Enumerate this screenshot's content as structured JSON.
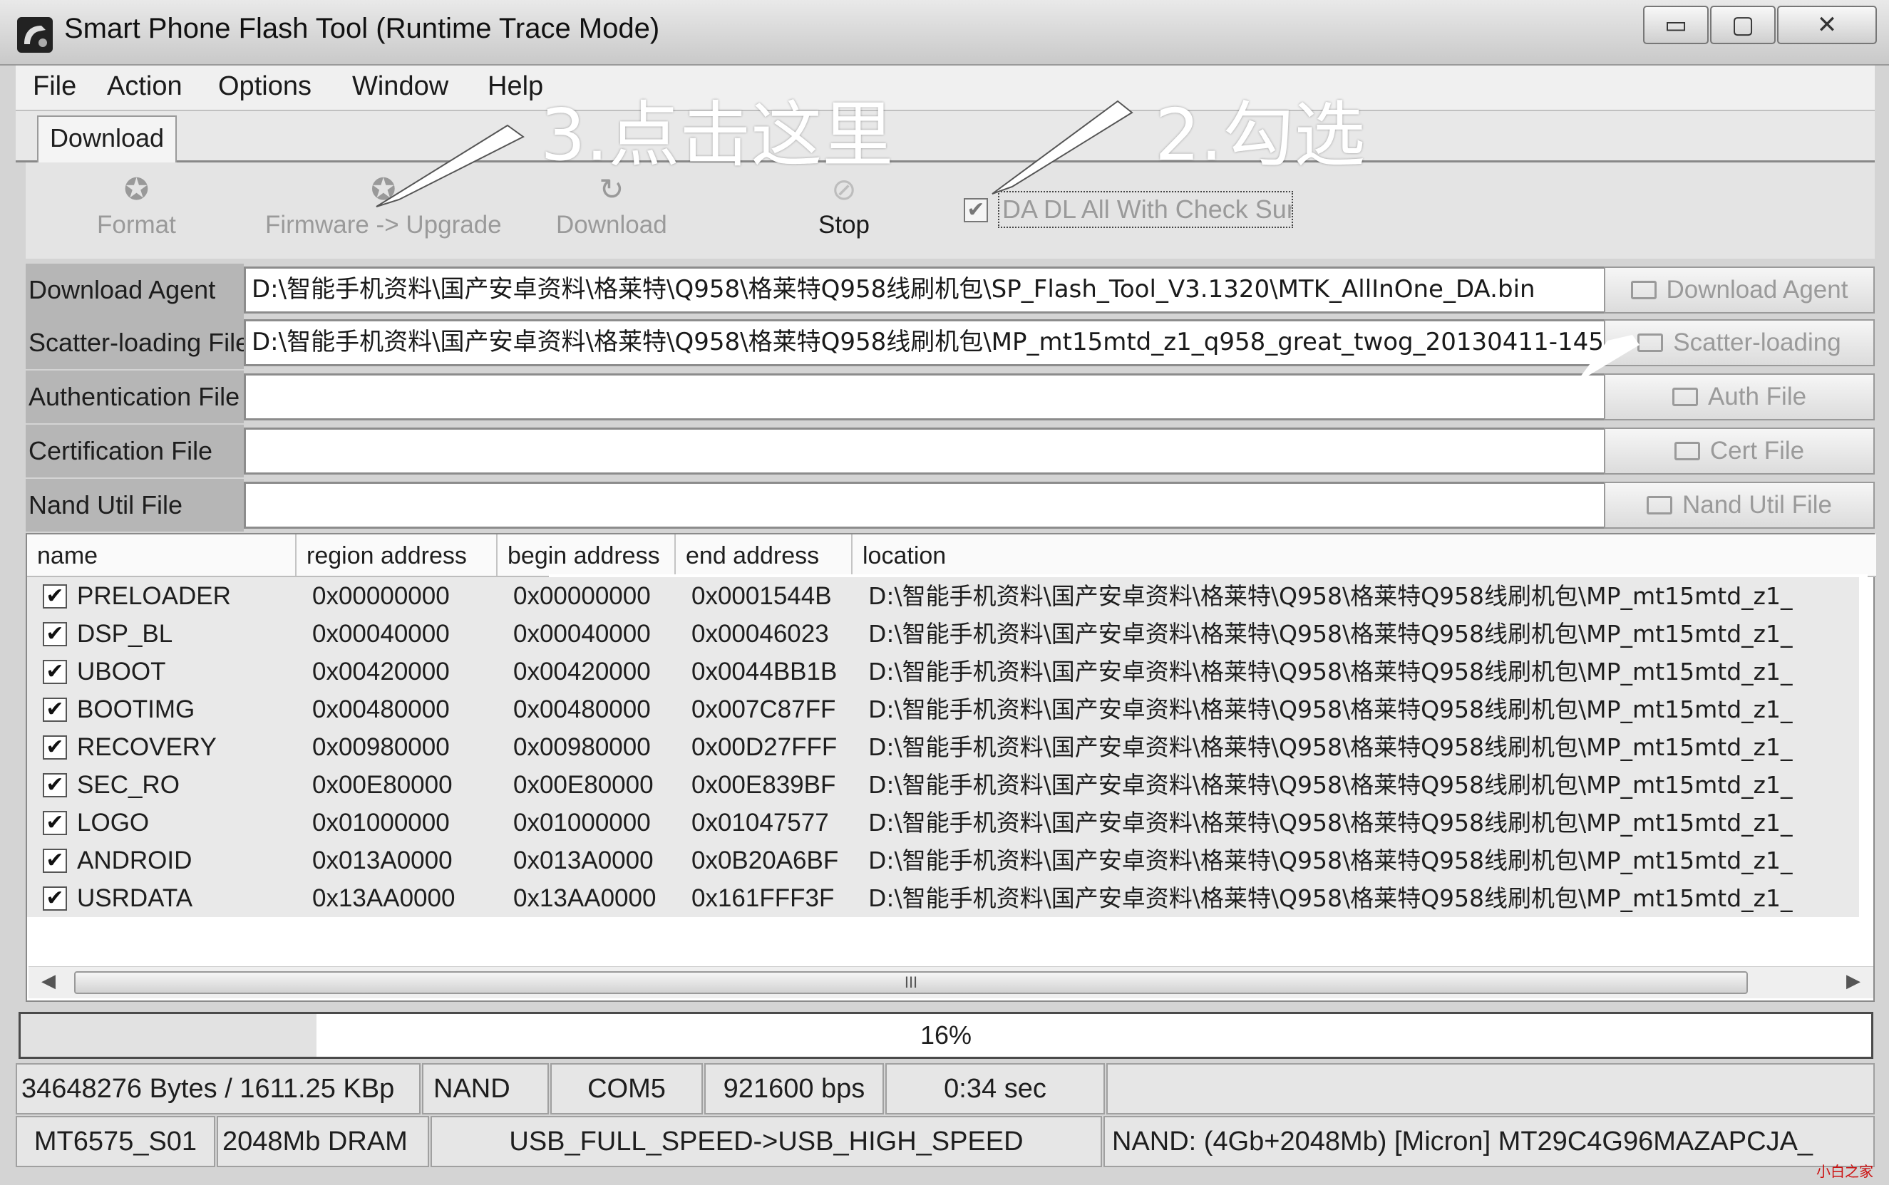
{
  "window": {
    "title": "Smart Phone Flash Tool (Runtime Trace Mode)",
    "buttons": {
      "minimize": "▭",
      "maximize": "▢",
      "close": "✕"
    }
  },
  "menu": [
    "File",
    "Action",
    "Options",
    "Window",
    "Help"
  ],
  "tab": {
    "label": "Download"
  },
  "toolbar": {
    "format": "Format",
    "firmware_upgrade": "Firmware -> Upgrade",
    "download": "Download",
    "stop": "Stop",
    "checksum_label": "DA DL All With Check Sum",
    "checksum_checked": true
  },
  "files": [
    {
      "label": "Download Agent",
      "value": "D:\\智能手机资料\\国产安卓资料\\格莱特\\Q958\\格莱特Q958线刷机包\\SP_Flash_Tool_V3.1320\\MTK_AllInOne_DA.bin",
      "button": "Download Agent"
    },
    {
      "label": "Scatter-loading File",
      "value": "D:\\智能手机资料\\国产安卓资料\\格莱特\\Q958\\格莱特Q958线刷机包\\MP_mt15mtd_z1_q958_great_twog_20130411-145",
      "button": "Scatter-loading"
    },
    {
      "label": "Authentication File",
      "value": "",
      "button": "Auth File"
    },
    {
      "label": "Certification File",
      "value": "",
      "button": "Cert File"
    },
    {
      "label": "Nand Util File",
      "value": "",
      "button": "Nand Util File"
    }
  ],
  "table": {
    "headers": [
      "name",
      "region address",
      "begin address",
      "end address",
      "location"
    ],
    "rows": [
      {
        "name": "PRELOADER",
        "region": "0x00000000",
        "begin": "0x00000000",
        "end": "0x0001544B",
        "location": "D:\\智能手机资料\\国产安卓资料\\格莱特\\Q958\\格莱特Q958线刷机包\\MP_mt15mtd_z1_"
      },
      {
        "name": "DSP_BL",
        "region": "0x00040000",
        "begin": "0x00040000",
        "end": "0x00046023",
        "location": "D:\\智能手机资料\\国产安卓资料\\格莱特\\Q958\\格莱特Q958线刷机包\\MP_mt15mtd_z1_"
      },
      {
        "name": "UBOOT",
        "region": "0x00420000",
        "begin": "0x00420000",
        "end": "0x0044BB1B",
        "location": "D:\\智能手机资料\\国产安卓资料\\格莱特\\Q958\\格莱特Q958线刷机包\\MP_mt15mtd_z1_"
      },
      {
        "name": "BOOTIMG",
        "region": "0x00480000",
        "begin": "0x00480000",
        "end": "0x007C87FF",
        "location": "D:\\智能手机资料\\国产安卓资料\\格莱特\\Q958\\格莱特Q958线刷机包\\MP_mt15mtd_z1_"
      },
      {
        "name": "RECOVERY",
        "region": "0x00980000",
        "begin": "0x00980000",
        "end": "0x00D27FFF",
        "location": "D:\\智能手机资料\\国产安卓资料\\格莱特\\Q958\\格莱特Q958线刷机包\\MP_mt15mtd_z1_"
      },
      {
        "name": "SEC_RO",
        "region": "0x00E80000",
        "begin": "0x00E80000",
        "end": "0x00E839BF",
        "location": "D:\\智能手机资料\\国产安卓资料\\格莱特\\Q958\\格莱特Q958线刷机包\\MP_mt15mtd_z1_"
      },
      {
        "name": "LOGO",
        "region": "0x01000000",
        "begin": "0x01000000",
        "end": "0x01047577",
        "location": "D:\\智能手机资料\\国产安卓资料\\格莱特\\Q958\\格莱特Q958线刷机包\\MP_mt15mtd_z1_"
      },
      {
        "name": "ANDROID",
        "region": "0x013A0000",
        "begin": "0x013A0000",
        "end": "0x0B20A6BF",
        "location": "D:\\智能手机资料\\国产安卓资料\\格莱特\\Q958\\格莱特Q958线刷机包\\MP_mt15mtd_z1_"
      },
      {
        "name": "USRDATA",
        "region": "0x13AA0000",
        "begin": "0x13AA0000",
        "end": "0x161FFF3F",
        "location": "D:\\智能手机资料\\国产安卓资料\\格莱特\\Q958\\格莱特Q958线刷机包\\MP_mt15mtd_z1_"
      }
    ],
    "scroll_grip": "III"
  },
  "progress": {
    "percent": 16,
    "label": "16%"
  },
  "status1": {
    "bytes": "34648276 Bytes / 1611.25 KBp",
    "storage": "NAND",
    "port": "COM5",
    "baud": "921600 bps",
    "time": "0:34 sec"
  },
  "status2": {
    "chip": "MT6575_S01",
    "ram": "2048Mb DRAM",
    "usb": "USB_FULL_SPEED->USB_HIGH_SPEED",
    "nand": "NAND: (4Gb+2048Mb) [Micron] MT29C4G96MAZAPCJA_"
  },
  "annotations": {
    "step3": "3.点击这里",
    "step2": "2.勾选"
  },
  "watermark": "小白之家",
  "colors": {
    "checked_mark": "#111111",
    "annotation": "#ffffff",
    "watermark": "#cc1111"
  }
}
